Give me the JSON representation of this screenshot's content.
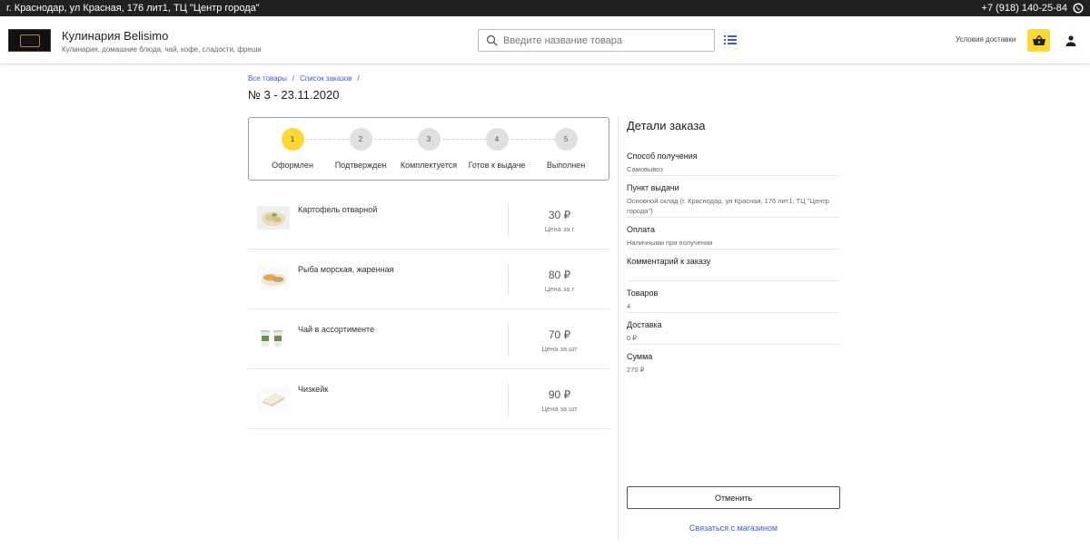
{
  "topbar": {
    "address": "г. Краснодар, ул Красная, 176 лит1, ТЦ \"Центр города\"",
    "phone": "+7 (918) 140-25-84"
  },
  "header": {
    "shop_name": "Кулинария Belisimo",
    "shop_subtitle": "Кулинария, домашние блюда, чай, кофе, сладости, фреши",
    "search_placeholder": "Введите название товара",
    "delivery_link": "Условия доставки"
  },
  "breadcrumb": {
    "item1": "Все товары",
    "item2": "Список заказов",
    "sep": "/"
  },
  "order": {
    "title": "№ 3 - 23.11.2020"
  },
  "steps": [
    {
      "num": "1",
      "label": "Оформлен"
    },
    {
      "num": "2",
      "label": "Подтвержден"
    },
    {
      "num": "3",
      "label": "Комплектуется"
    },
    {
      "num": "4",
      "label": "Готов к выдаче"
    },
    {
      "num": "5",
      "label": "Выполнен"
    }
  ],
  "items": [
    {
      "name": "Картофель отварной",
      "price": "30 ₽",
      "unit": "Цена за г"
    },
    {
      "name": "Рыба морская, жаренная",
      "price": "80 ₽",
      "unit": "Цена за г"
    },
    {
      "name": "Чай в ассортименте",
      "price": "70 ₽",
      "unit": "Цена за шт"
    },
    {
      "name": "Чизкейк",
      "price": "90 ₽",
      "unit": "Цена за шт"
    }
  ],
  "details": {
    "title": "Детали заказа",
    "receive_label": "Способ получения",
    "receive_value": "Самовывоз",
    "pickup_label": "Пункт выдачи",
    "pickup_value": "Основной склад (г. Краснодар, ул Красная, 176 лит1, ТЦ \"Центр города\")",
    "payment_label": "Оплата",
    "payment_value": "Наличными при получении",
    "comment_label": "Комментарий к заказу",
    "count_label": "Товаров",
    "count_value": "4",
    "delivery_label": "Доставка",
    "delivery_value": "0 ₽",
    "sum_label": "Сумма",
    "sum_value": "270 ₽"
  },
  "actions": {
    "cancel": "Отменить",
    "contact": "Связаться с магазином"
  },
  "colors": {
    "accent": "#fdd835",
    "link": "#3b5bdb",
    "topbar": "#212121",
    "whatsapp": "#25d366"
  }
}
